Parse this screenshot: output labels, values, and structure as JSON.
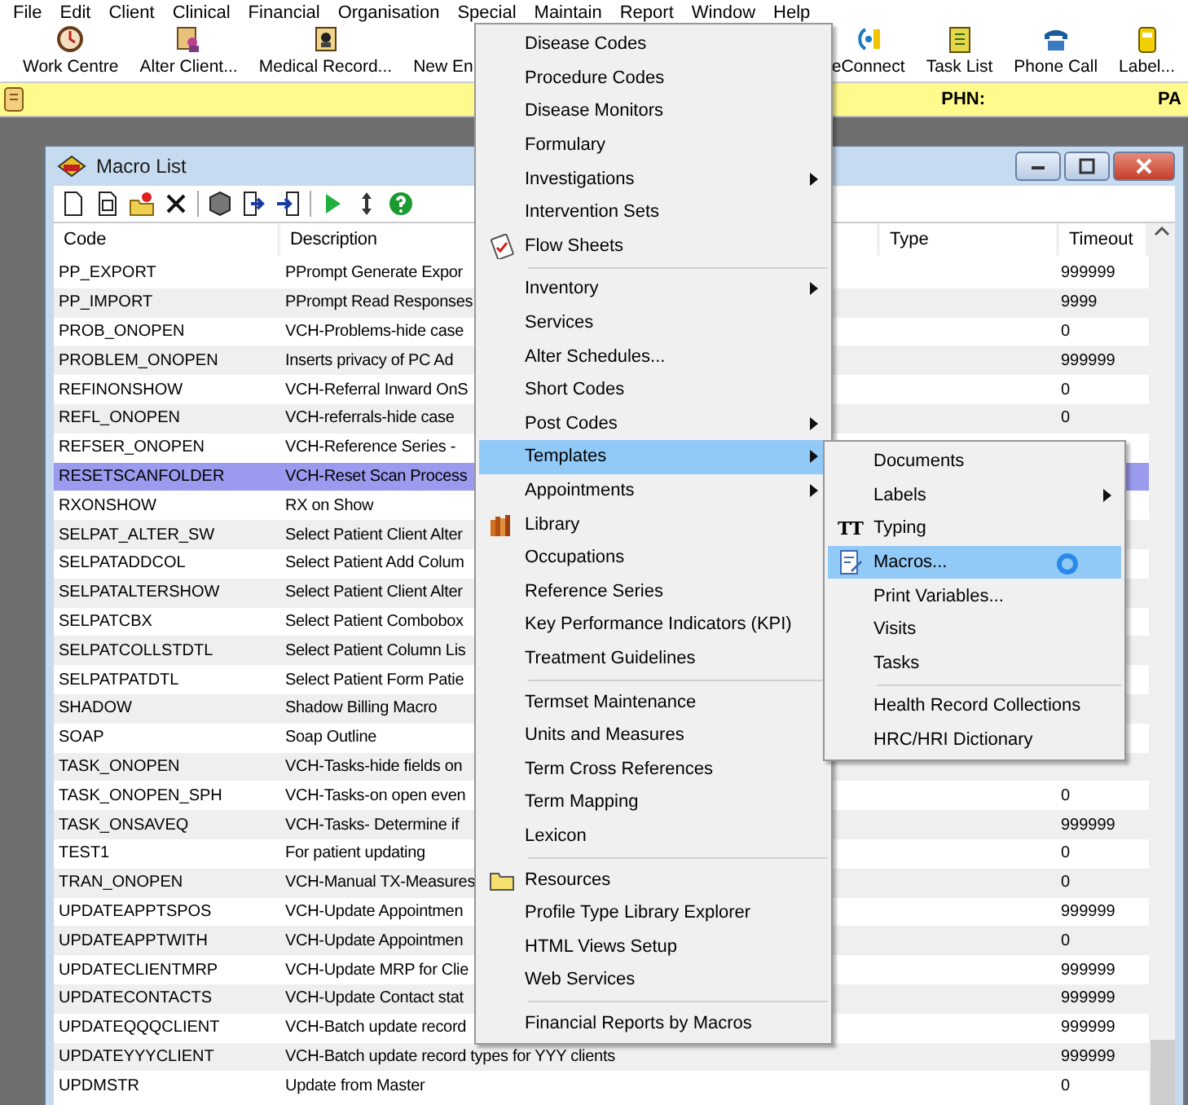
{
  "menubar": [
    {
      "label": "File"
    },
    {
      "label": "Edit"
    },
    {
      "label": "Client"
    },
    {
      "label": "Clinical"
    },
    {
      "label": "Financial"
    },
    {
      "label": "Organisation"
    },
    {
      "label": "Special"
    },
    {
      "label": "Maintain"
    },
    {
      "label": "Report"
    },
    {
      "label": "Window"
    },
    {
      "label": "Help"
    }
  ],
  "toolbar": {
    "start": [
      {
        "label": "Work Centre"
      },
      {
        "label": "Alter Client..."
      },
      {
        "label": "Medical Record..."
      },
      {
        "label": "New En"
      }
    ],
    "end": [
      {
        "label": "eConnect"
      },
      {
        "label": "Task List"
      },
      {
        "label": "Phone Call"
      },
      {
        "label": "Label..."
      }
    ]
  },
  "patient_bar": {
    "phn_label": "PHN:",
    "field_2_label": "PA"
  },
  "macro_window": {
    "title": "Macro List",
    "columns": [
      "Code",
      "Description",
      "Type",
      "Timeout"
    ],
    "rows": [
      {
        "code": "PP_EXPORT",
        "description": "PPrompt Generate Expor",
        "timeout": "999999",
        "selected": false
      },
      {
        "code": "PP_IMPORT",
        "description": "PPrompt Read Responses",
        "timeout": "9999",
        "selected": false
      },
      {
        "code": "PROB_ONOPEN",
        "description": "VCH-Problems-hide case",
        "timeout": "0",
        "selected": false
      },
      {
        "code": "PROBLEM_ONOPEN",
        "description": "Inserts privacy of PC Ad",
        "timeout": "999999",
        "selected": false
      },
      {
        "code": "REFINONSHOW",
        "description": "VCH-Referral Inward OnS",
        "timeout": "0",
        "selected": false
      },
      {
        "code": "REFL_ONOPEN",
        "description": "VCH-referrals-hide case",
        "timeout": "0",
        "selected": false
      },
      {
        "code": "REFSER_ONOPEN",
        "description": "VCH-Reference Series -",
        "selected": false
      },
      {
        "code": "RESETSCANFOLDER",
        "description": "VCH-Reset Scan Process",
        "selected": true
      },
      {
        "code": "RXONSHOW",
        "description": "RX on Show",
        "selected": false
      },
      {
        "code": "SELPAT_ALTER_SW",
        "description": "Select Patient Client Alter",
        "selected": false
      },
      {
        "code": "SELPATADDCOL",
        "description": "Select Patient Add Colum",
        "selected": false
      },
      {
        "code": "SELPATALTERSHOW",
        "description": "Select Patient Client Alter",
        "selected": false
      },
      {
        "code": "SELPATCBX",
        "description": "Select Patient Combobox",
        "selected": false
      },
      {
        "code": "SELPATCOLLSTDTL",
        "description": "Select Patient Column Lis",
        "selected": false
      },
      {
        "code": "SELPATPATDTL",
        "description": "Select Patient Form Patie",
        "selected": false
      },
      {
        "code": "SHADOW",
        "description": "Shadow Billing Macro",
        "selected": false
      },
      {
        "code": "SOAP",
        "description": "Soap Outline",
        "selected": false
      },
      {
        "code": "TASK_ONOPEN",
        "description": "VCH-Tasks-hide fields on",
        "selected": false
      },
      {
        "code": "TASK_ONOPEN_SPH",
        "description": "VCH-Tasks-on open even",
        "timeout": "0",
        "selected": false
      },
      {
        "code": "TASK_ONSAVEQ",
        "description": "VCH-Tasks- Determine if",
        "timeout": "999999",
        "selected": false
      },
      {
        "code": "TEST1",
        "description": "For patient updating",
        "timeout": "0",
        "selected": false
      },
      {
        "code": "TRAN_ONOPEN",
        "description": "VCH-Manual TX-Measures",
        "timeout": "0",
        "selected": false
      },
      {
        "code": "UPDATEAPPTSPOS",
        "description": "VCH-Update Appointmen",
        "timeout": "999999",
        "selected": false
      },
      {
        "code": "UPDATEAPPTWITH",
        "description": "VCH-Update Appointmen",
        "timeout": "0",
        "selected": false
      },
      {
        "code": "UPDATECLIENTMRP",
        "description": "VCH-Update MRP for Clie",
        "timeout": "999999",
        "selected": false
      },
      {
        "code": "UPDATECONTACTS",
        "description": "VCH-Update Contact stat",
        "timeout": "999999",
        "selected": false
      },
      {
        "code": "UPDATEQQQCLIENT",
        "description": "VCH-Batch update record",
        "timeout": "999999",
        "selected": false
      },
      {
        "code": "UPDATEYYYCLIENT",
        "description": "VCH-Batch update record types for YYY clients",
        "timeout": "999999",
        "selected": false
      },
      {
        "code": "UPDMSTR",
        "description": "Update from Master",
        "timeout": "0",
        "selected": false
      }
    ]
  },
  "maintain_menu": [
    {
      "kind": "item",
      "label": "Disease Codes",
      "submenu": false,
      "selected": false
    },
    {
      "kind": "item",
      "label": "Procedure Codes",
      "submenu": false,
      "selected": false
    },
    {
      "kind": "item",
      "label": "Disease Monitors",
      "submenu": false,
      "selected": false
    },
    {
      "kind": "item",
      "label": "Formulary",
      "submenu": false,
      "selected": false
    },
    {
      "kind": "item",
      "label": "Investigations",
      "submenu": true,
      "selected": false
    },
    {
      "kind": "item",
      "label": "Intervention Sets",
      "submenu": false,
      "selected": false
    },
    {
      "kind": "item",
      "label": "Flow Sheets",
      "submenu": false,
      "selected": false
    },
    {
      "kind": "separator"
    },
    {
      "kind": "item",
      "label": "Inventory",
      "submenu": true,
      "selected": false
    },
    {
      "kind": "item",
      "label": "Services",
      "submenu": false,
      "selected": false
    },
    {
      "kind": "item",
      "label": "Alter Schedules...",
      "submenu": false,
      "selected": false
    },
    {
      "kind": "item",
      "label": "Short Codes",
      "submenu": false,
      "selected": false
    },
    {
      "kind": "item",
      "label": "Post Codes",
      "submenu": true,
      "selected": false
    },
    {
      "kind": "item",
      "label": "Templates",
      "submenu": true,
      "selected": true
    },
    {
      "kind": "item",
      "label": "Appointments",
      "submenu": true,
      "selected": false
    },
    {
      "kind": "item",
      "label": "Library",
      "submenu": false,
      "selected": false
    },
    {
      "kind": "item",
      "label": "Occupations",
      "submenu": false,
      "selected": false
    },
    {
      "kind": "item",
      "label": "Reference Series",
      "submenu": false,
      "selected": false
    },
    {
      "kind": "item",
      "label": "Key Performance Indicators (KPI)",
      "submenu": false,
      "selected": false
    },
    {
      "kind": "item",
      "label": "Treatment Guidelines",
      "submenu": false,
      "selected": false
    },
    {
      "kind": "separator"
    },
    {
      "kind": "item",
      "label": "Termset Maintenance",
      "submenu": false,
      "selected": false
    },
    {
      "kind": "item",
      "label": "Units and Measures",
      "submenu": false,
      "selected": false
    },
    {
      "kind": "item",
      "label": "Term Cross References",
      "submenu": false,
      "selected": false
    },
    {
      "kind": "item",
      "label": "Term Mapping",
      "submenu": false,
      "selected": false
    },
    {
      "kind": "item",
      "label": "Lexicon",
      "submenu": false,
      "selected": false
    },
    {
      "kind": "separator"
    },
    {
      "kind": "item",
      "label": "Resources",
      "submenu": false,
      "selected": false
    },
    {
      "kind": "item",
      "label": "Profile Type Library Explorer",
      "submenu": false,
      "selected": false
    },
    {
      "kind": "item",
      "label": "HTML Views Setup",
      "submenu": false,
      "selected": false
    },
    {
      "kind": "item",
      "label": "Web Services",
      "submenu": false,
      "selected": false
    },
    {
      "kind": "separator"
    },
    {
      "kind": "item",
      "label": "Financial Reports by Macros",
      "submenu": false,
      "selected": false
    }
  ],
  "templates_submenu": [
    {
      "kind": "item",
      "label": "Documents",
      "submenu": false,
      "selected": false
    },
    {
      "kind": "item",
      "label": "Labels",
      "submenu": true,
      "selected": false
    },
    {
      "kind": "item",
      "label": "Typing",
      "glyph": "TT",
      "submenu": false,
      "selected": false
    },
    {
      "kind": "item",
      "label": "Macros...",
      "submenu": false,
      "selected": true
    },
    {
      "kind": "item",
      "label": "Print Variables...",
      "submenu": false,
      "selected": false
    },
    {
      "kind": "item",
      "label": "Visits",
      "submenu": false,
      "selected": false
    },
    {
      "kind": "item",
      "label": "Tasks",
      "submenu": false,
      "selected": false
    },
    {
      "kind": "separator"
    },
    {
      "kind": "item",
      "label": "Health Record Collections",
      "submenu": false,
      "selected": false
    },
    {
      "kind": "item",
      "label": "HRC/HRI Dictionary",
      "submenu": false,
      "selected": false
    }
  ]
}
